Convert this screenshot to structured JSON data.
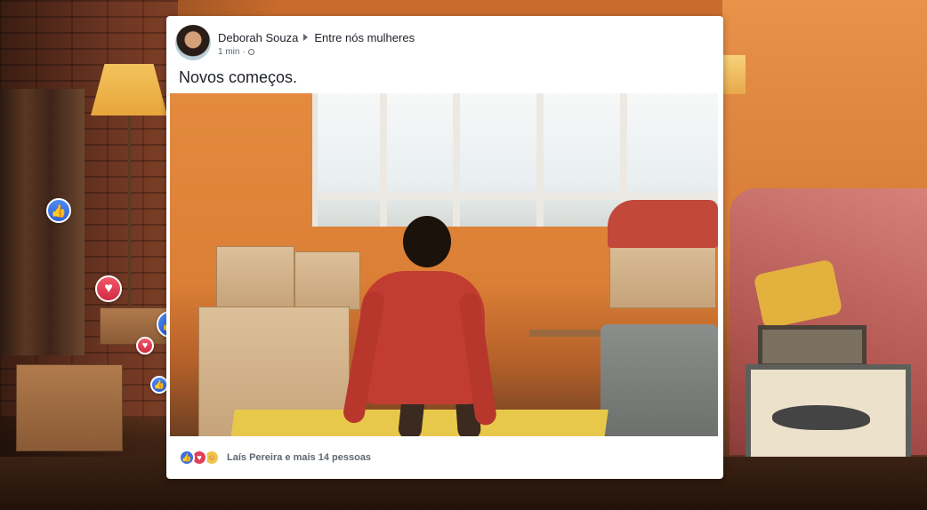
{
  "post": {
    "author": "Deborah Souza",
    "group": "Entre nós mulheres",
    "time": "1 min ·",
    "text": "Novos começos."
  },
  "reactions_summary": {
    "text": "Laís Pereira e mais 14 pessoas",
    "icons": [
      "like-icon",
      "love-icon",
      "care-icon"
    ]
  },
  "floating_reactions": [
    "like",
    "love",
    "love",
    "like",
    "love",
    "like",
    "love",
    "like",
    "love",
    "like",
    "love"
  ],
  "colors": {
    "like": "#3b6fe0",
    "love": "#e0405a",
    "card": "#ffffff",
    "text_primary": "#1d2129",
    "text_secondary": "#606770"
  }
}
